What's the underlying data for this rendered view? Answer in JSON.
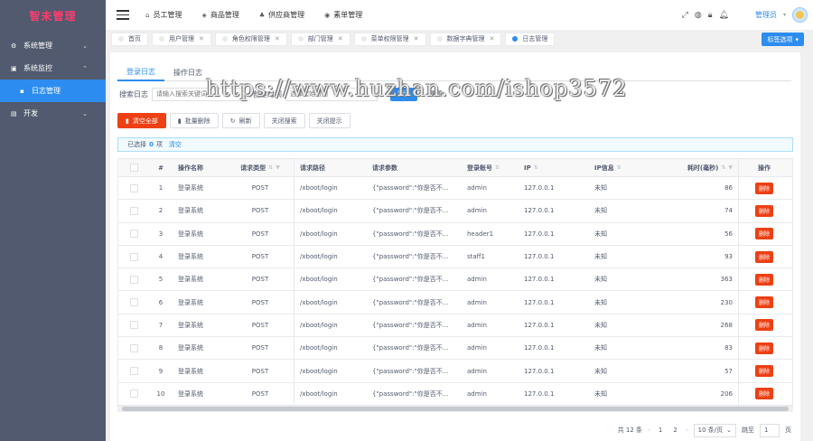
{
  "app": {
    "logo": "智未管理"
  },
  "sidebar": {
    "items": [
      {
        "label": "系统管理",
        "icon": "settings-icon",
        "expanded": false
      },
      {
        "label": "系统监控",
        "icon": "monitor-icon",
        "expanded": true,
        "children": [
          {
            "label": "日志管理",
            "icon": "log-icon",
            "active": true
          }
        ]
      },
      {
        "label": "开发",
        "icon": "code-icon",
        "expanded": false
      }
    ]
  },
  "topbar": {
    "nav": [
      {
        "label": "员工管理",
        "icon": "home-icon"
      },
      {
        "label": "商品管理",
        "icon": "tag-icon"
      },
      {
        "label": "供应商管理",
        "icon": "flask-icon"
      },
      {
        "label": "素单管理",
        "icon": "camera-icon"
      }
    ],
    "user": "管理员"
  },
  "tabs": {
    "items": [
      {
        "label": "首页",
        "closable": false,
        "active": false
      },
      {
        "label": "用户管理",
        "closable": true,
        "active": false
      },
      {
        "label": "角色权限管理",
        "closable": true,
        "active": false
      },
      {
        "label": "部门管理",
        "closable": true,
        "active": false
      },
      {
        "label": "菜单权限管理",
        "closable": true,
        "active": false
      },
      {
        "label": "数据字典管理",
        "closable": true,
        "active": false
      },
      {
        "label": "日志管理",
        "closable": false,
        "active": true
      }
    ],
    "options_label": "标签选项"
  },
  "subtabs": [
    {
      "label": "登录日志",
      "active": true
    },
    {
      "label": "操作日志",
      "active": false
    }
  ],
  "search": {
    "label": "搜索日志",
    "placeholder": "请输入搜索关键词",
    "time_label": "创建时间",
    "time_placeholder": "选择起始时间",
    "search_button": "搜索",
    "reset_button": "重置"
  },
  "actions": {
    "clear_all": "清空全部",
    "batch_delete": "批量删除",
    "refresh": "刷新",
    "precise_search": "关闭搜索",
    "hide_hint": "关闭提示"
  },
  "selection": {
    "prefix": "已选择",
    "count": "0",
    "suffix": "项",
    "clear": "清空"
  },
  "table": {
    "headers": [
      "#",
      "操作名称",
      "请求类型",
      "请求路径",
      "请求参数",
      "登录账号",
      "IP",
      "IP信息",
      "耗时(毫秒)",
      "操作"
    ],
    "rows": [
      {
        "idx": "1",
        "name": "登录系统",
        "type": "POST",
        "path": "/xboot/login",
        "param": "{\"password\":\"你是否不...",
        "user": "admin",
        "ip": "127.0.0.1",
        "ipinfo": "未知",
        "time": "86",
        "op": "删除"
      },
      {
        "idx": "2",
        "name": "登录系统",
        "type": "POST",
        "path": "/xboot/login",
        "param": "{\"password\":\"你是否不...",
        "user": "admin",
        "ip": "127.0.0.1",
        "ipinfo": "未知",
        "time": "74",
        "op": "删除"
      },
      {
        "idx": "3",
        "name": "登录系统",
        "type": "POST",
        "path": "/xboot/login",
        "param": "{\"password\":\"你是否不...",
        "user": "header1",
        "ip": "127.0.0.1",
        "ipinfo": "未知",
        "time": "56",
        "op": "删除"
      },
      {
        "idx": "4",
        "name": "登录系统",
        "type": "POST",
        "path": "/xboot/login",
        "param": "{\"password\":\"你是否不...",
        "user": "staff1",
        "ip": "127.0.0.1",
        "ipinfo": "未知",
        "time": "93",
        "op": "删除"
      },
      {
        "idx": "5",
        "name": "登录系统",
        "type": "POST",
        "path": "/xboot/login",
        "param": "{\"password\":\"你是否不...",
        "user": "admin",
        "ip": "127.0.0.1",
        "ipinfo": "未知",
        "time": "363",
        "op": "删除"
      },
      {
        "idx": "6",
        "name": "登录系统",
        "type": "POST",
        "path": "/xboot/login",
        "param": "{\"password\":\"你是否不...",
        "user": "admin",
        "ip": "127.0.0.1",
        "ipinfo": "未知",
        "time": "230",
        "op": "删除"
      },
      {
        "idx": "7",
        "name": "登录系统",
        "type": "POST",
        "path": "/xboot/login",
        "param": "{\"password\":\"你是否不...",
        "user": "admin",
        "ip": "127.0.0.1",
        "ipinfo": "未知",
        "time": "268",
        "op": "删除"
      },
      {
        "idx": "8",
        "name": "登录系统",
        "type": "POST",
        "path": "/xboot/login",
        "param": "{\"password\":\"你是否不...",
        "user": "admin",
        "ip": "127.0.0.1",
        "ipinfo": "未知",
        "time": "83",
        "op": "删除"
      },
      {
        "idx": "9",
        "name": "登录系统",
        "type": "POST",
        "path": "/xboot/login",
        "param": "{\"password\":\"你是否不...",
        "user": "admin",
        "ip": "127.0.0.1",
        "ipinfo": "未知",
        "time": "57",
        "op": "删除"
      },
      {
        "idx": "10",
        "name": "登录系统",
        "type": "POST",
        "path": "/xboot/login",
        "param": "{\"password\":\"你是否不...",
        "user": "admin",
        "ip": "127.0.0.1",
        "ipinfo": "未知",
        "time": "206",
        "op": "删除"
      }
    ]
  },
  "pagination": {
    "total": "共 12 条",
    "pages": [
      "1",
      "2"
    ],
    "current": "1",
    "page_size": "10 条/页",
    "goto_label": "跳至",
    "goto_value": "1",
    "goto_suffix": "页"
  },
  "watermark": "https://www.huzhan.com/ishop3572"
}
